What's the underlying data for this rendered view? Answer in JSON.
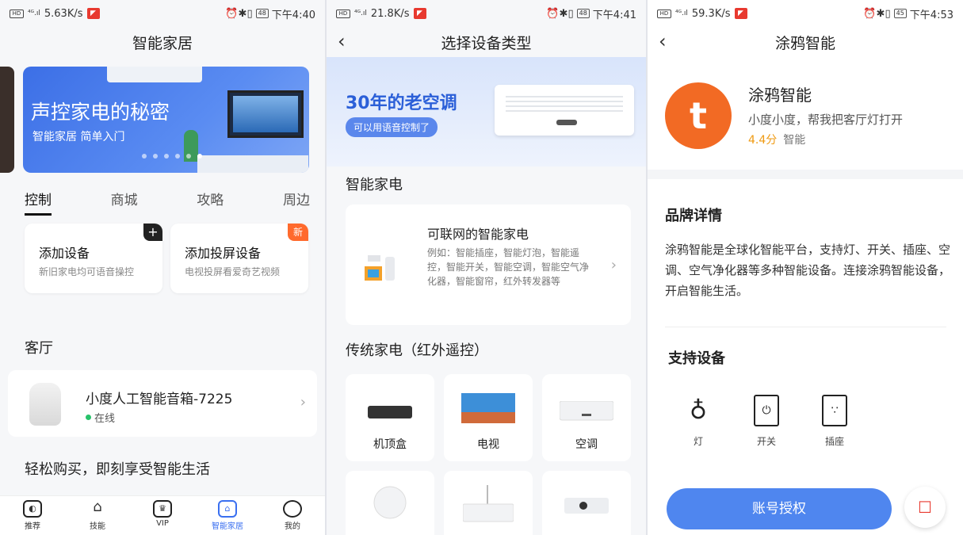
{
  "panel1": {
    "status": {
      "speed": "5.63K/s",
      "time": "下午4:40",
      "battery": "48"
    },
    "title": "智能家居",
    "banner": {
      "line1": "声控家电的秘密",
      "line2": "智能家居 简单入门"
    },
    "tabs": [
      "控制",
      "商城",
      "攻略",
      "周边"
    ],
    "cards": [
      {
        "title": "添加设备",
        "sub": "新旧家电均可语音操控",
        "badge": "+"
      },
      {
        "title": "添加投屏设备",
        "sub": "电视投屏看爱奇艺视频",
        "badge": "新"
      }
    ],
    "room": "客厅",
    "device": {
      "name": "小度人工智能音箱-7225",
      "status": "在线"
    },
    "promo": "轻松购买，即刻享受智能生活",
    "bottom_nav": [
      "推荐",
      "技能",
      "VIP",
      "智能家居",
      "我的"
    ]
  },
  "panel2": {
    "status": {
      "speed": "21.8K/s",
      "time": "下午4:41",
      "battery": "48"
    },
    "title": "选择设备类型",
    "hero": {
      "headline": "30年的老空调",
      "pill": "可以用语音控制了"
    },
    "section1": "智能家电",
    "smart": {
      "title": "可联网的智能家电",
      "desc": "例如：智能插座，智能灯泡，智能遥控，智能开关，智能空调，智能空气净化器，智能窗帘，红外转发器等"
    },
    "section2": "传统家电（红外遥控）",
    "grid": [
      "机顶盒",
      "电视",
      "空调"
    ]
  },
  "panel3": {
    "status": {
      "speed": "59.3K/s",
      "time": "下午4:53",
      "battery": "45"
    },
    "title": "涂鸦智能",
    "brand": {
      "name": "涂鸦智能",
      "desc": "小度小度，帮我把客厅灯打开",
      "score": "4.4分",
      "category": "智能"
    },
    "detail_title": "品牌详情",
    "detail_text": "涂鸦智能是全球化智能平台，支持灯、开关、插座、空调、空气净化器等多种智能设备。连接涂鸦智能设备，开启智能生活。",
    "support_title": "支持设备",
    "supports": [
      "灯",
      "开关",
      "插座"
    ],
    "auth_button": "账号授权"
  },
  "colors": {
    "accent": "#3a6ff0",
    "brand_orange": "#f26a24",
    "online": "#27c26a",
    "new_badge": "#ff6a2d"
  }
}
